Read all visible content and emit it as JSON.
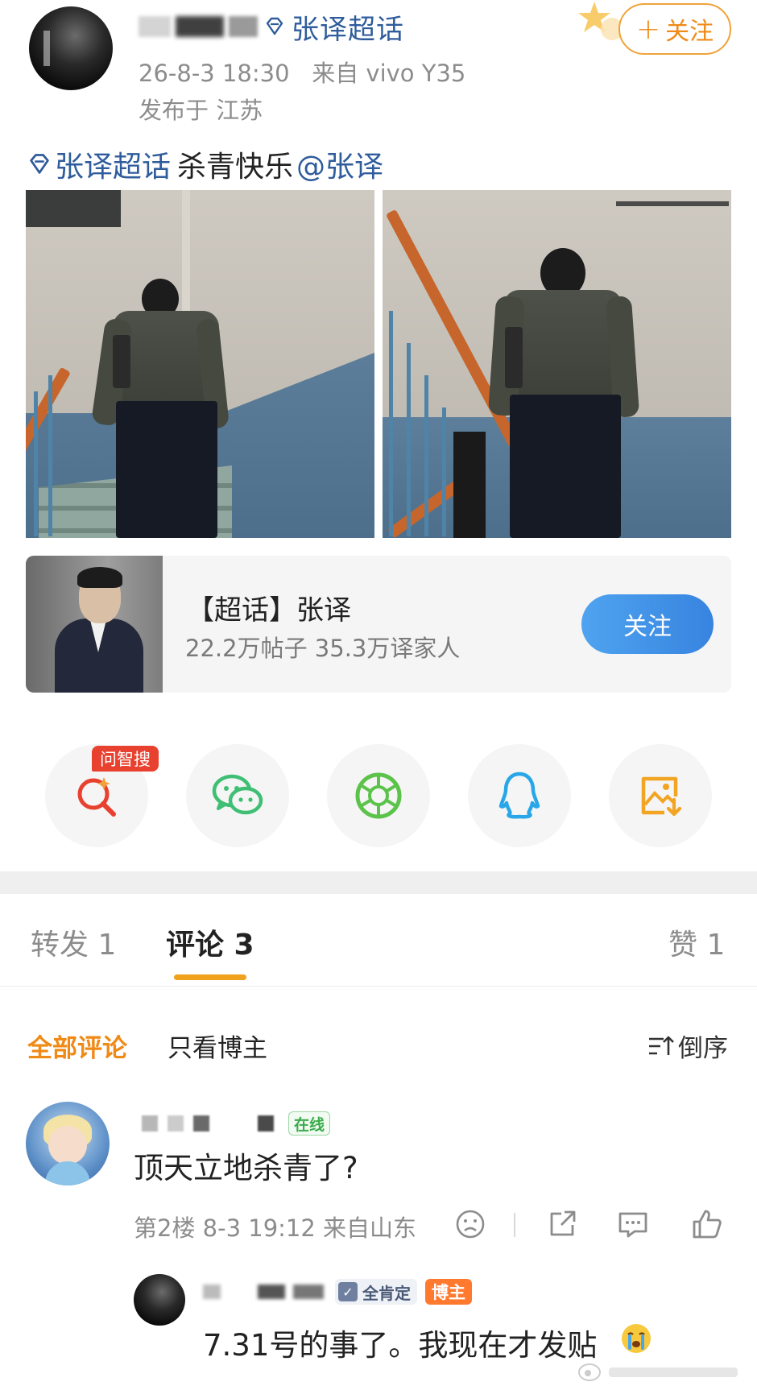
{
  "post": {
    "topic_name": "张译超话",
    "timestamp": "26-8-3 18:30",
    "source_prefix": "来自",
    "device": "vivo Y35",
    "location": "发布于 江苏",
    "follow_label": "关注",
    "body": {
      "topic_link": "张译超话",
      "text": "杀青快乐",
      "mention": "@张译"
    }
  },
  "supertopic_card": {
    "title": "【超话】张译",
    "stats": "22.2万帖子 35.3万译家人",
    "follow_label": "关注"
  },
  "share_row": {
    "badge": "问智搜",
    "items": [
      "search-ai-icon",
      "wechat-icon",
      "moments-icon",
      "qq-icon",
      "save-image-icon"
    ]
  },
  "tabs": {
    "repost": "转发 1",
    "comments": "评论 3",
    "likes": "赞 1"
  },
  "filters": {
    "all": "全部评论",
    "host_only": "只看博主",
    "sort": "倒序"
  },
  "comment": {
    "online_badge": "在线",
    "text": "顶天立地杀青了?",
    "meta": "第2楼 8-3 19:12 来自山东"
  },
  "reply": {
    "approve_badge": "全肯定",
    "host_badge": "博主",
    "text": "7.31号的事了。我现在才发贴"
  },
  "colors": {
    "link": "#2f5c9c",
    "accent_orange": "#ef8a16",
    "follow_blue": "#3784e0",
    "badge_red": "#e8412f",
    "online_green": "#3cab4c"
  }
}
